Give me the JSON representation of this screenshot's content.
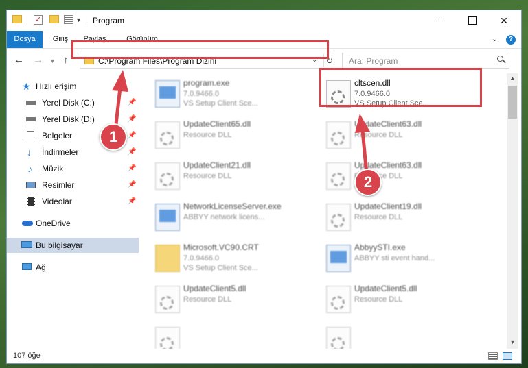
{
  "window": {
    "title": "Program"
  },
  "ribbon": {
    "tabs": [
      {
        "label": "Dosya"
      },
      {
        "label": "Giriş"
      },
      {
        "label": "Paylaş"
      },
      {
        "label": "Görünüm"
      }
    ],
    "help": "?"
  },
  "address": {
    "path": "C:\\Program Files\\Program Dizini"
  },
  "search": {
    "placeholder": "Ara: Program"
  },
  "sidebar": {
    "items": [
      {
        "label": "Hızlı erişim",
        "icon": "star-icon"
      },
      {
        "label": "Yerel Disk (C:)",
        "icon": "drive-icon"
      },
      {
        "label": "Yerel Disk (D:)",
        "icon": "drive-icon"
      },
      {
        "label": "Belgeler",
        "icon": "documents-icon"
      },
      {
        "label": "İndirmeler",
        "icon": "download-icon"
      },
      {
        "label": "Müzik",
        "icon": "music-icon"
      },
      {
        "label": "Resimler",
        "icon": "pictures-icon"
      },
      {
        "label": "Videolar",
        "icon": "video-icon"
      },
      {
        "label": "OneDrive",
        "icon": "cloud-icon"
      },
      {
        "label": "Bu bilgisayar",
        "icon": "computer-icon"
      },
      {
        "label": "Ağ",
        "icon": "network-icon"
      }
    ]
  },
  "files": [
    {
      "name": "program.exe",
      "line2": "7.0.9466.0",
      "line3": "VS Setup Client Sce..."
    },
    {
      "name": "cltscen.dll",
      "line2": "7.0.9466.0",
      "line3": "VS Setup Client Sce..."
    },
    {
      "name": "UpdateClient65.dll",
      "line2": "Resource DLL",
      "line3": ""
    },
    {
      "name": "UpdateClient63.dll",
      "line2": "Resource DLL",
      "line3": ""
    },
    {
      "name": "UpdateClient21.dll",
      "line2": "Resource DLL",
      "line3": ""
    },
    {
      "name": "UpdateClient63.dll",
      "line2": "Resource DLL",
      "line3": ""
    },
    {
      "name": "NetworkLicenseServer.exe",
      "line2": "ABBYY network licens...",
      "line3": ""
    },
    {
      "name": "UpdateClient19.dll",
      "line2": "Resource DLL",
      "line3": ""
    },
    {
      "name": "Microsoft.VC90.CRT",
      "line2": "7.0.9466.0",
      "line3": "VS Setup Client Sce..."
    },
    {
      "name": "AbbyySTI.exe",
      "line2": "ABBYY sti event hand...",
      "line3": ""
    },
    {
      "name": "UpdateClient5.dll",
      "line2": "Resource DLL",
      "line3": ""
    },
    {
      "name": "UpdateClient5.dll",
      "line2": "Resource DLL",
      "line3": ""
    }
  ],
  "status": {
    "count": "107 öğe"
  },
  "annotations": {
    "step1": "1",
    "step2": "2",
    "color": "#d94249"
  }
}
